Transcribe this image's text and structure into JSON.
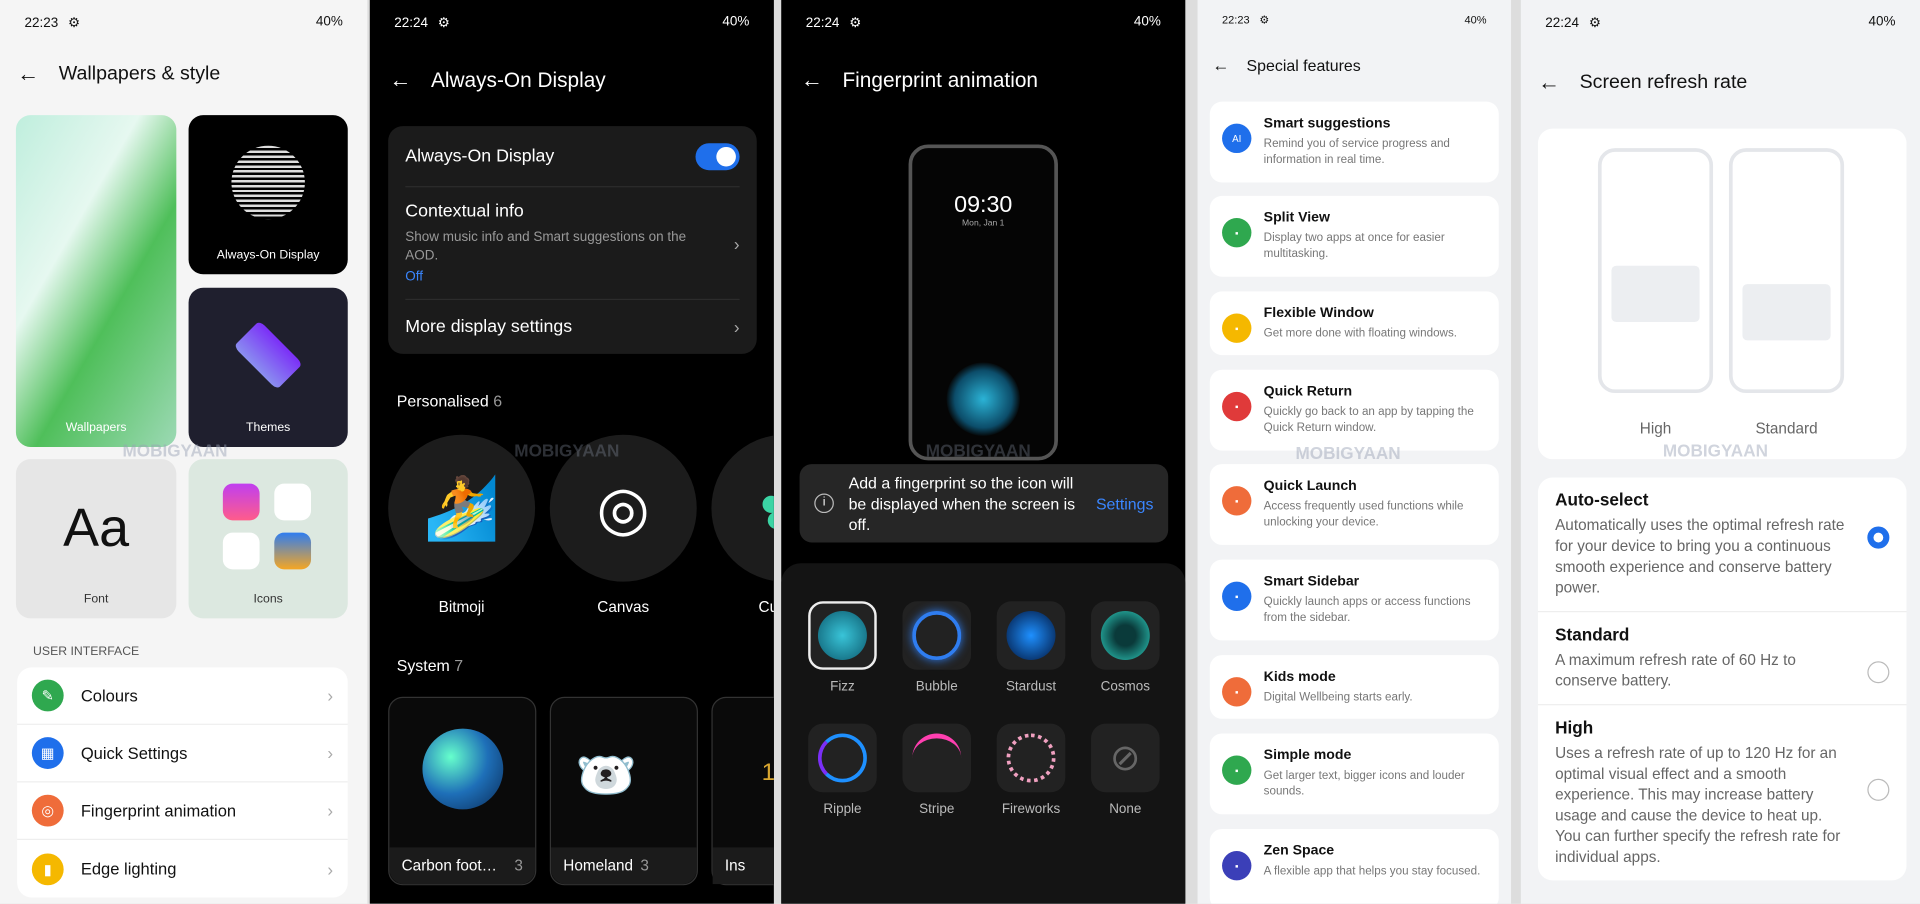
{
  "panel1": {
    "time": "22:23",
    "battery": "40%",
    "title": "Wallpapers & style",
    "tiles": [
      "Wallpapers",
      "Always-On Display",
      "Themes",
      "Font",
      "Icons"
    ],
    "font_sample": "Aa",
    "section": "USER INTERFACE",
    "items": [
      {
        "label": "Colours",
        "color": "#2fa84f"
      },
      {
        "label": "Quick Settings",
        "color": "#1f6feb"
      },
      {
        "label": "Fingerprint animation",
        "color": "#ef6c3a"
      },
      {
        "label": "Edge lighting",
        "color": "#f5b800"
      }
    ]
  },
  "panel2": {
    "time": "22:24",
    "battery": "40%",
    "title": "Always-On Display",
    "aod_label": "Always-On Display",
    "aod_on": true,
    "contextual_title": "Contextual info",
    "contextual_desc": "Show music info and Smart suggestions on the AOD.",
    "contextual_value": "Off",
    "more": "More display settings",
    "personalised": "Personalised",
    "personalised_count": "6",
    "personal_items": [
      "Bitmoji",
      "Canvas",
      "Custom"
    ],
    "system": "System",
    "system_count": "7",
    "system_items": [
      {
        "label": "Carbon foot…",
        "count": "3"
      },
      {
        "label": "Homeland",
        "count": "3"
      },
      {
        "label": "Ins"
      }
    ]
  },
  "panel3": {
    "time": "22:24",
    "battery": "40%",
    "title": "Fingerprint animation",
    "clock": "09:30",
    "date": "Mon, Jan 1",
    "notice": "Add a fingerprint so the icon will be displayed when the screen is off.",
    "settings_link": "Settings",
    "animations": [
      "Fizz",
      "Bubble",
      "Stardust",
      "Cosmos",
      "Ripple",
      "Stripe",
      "Fireworks",
      "None"
    ],
    "selected": "Fizz"
  },
  "panel4": {
    "time": "22:23",
    "battery": "40%",
    "title": "Special features",
    "items": [
      {
        "title": "Smart suggestions",
        "desc": "Remind you of service progress and information in real time.",
        "color": "#1f6feb",
        "icon": "AI"
      },
      {
        "title": "Split View",
        "desc": "Display two apps at once for easier multitasking.",
        "color": "#2fa84f"
      },
      {
        "title": "Flexible Window",
        "desc": "Get more done with floating windows.",
        "color": "#f5b800"
      },
      {
        "title": "Quick Return",
        "desc": "Quickly go back to an app by tapping the Quick Return window.",
        "color": "#e03a3a"
      },
      {
        "title": "Quick Launch",
        "desc": "Access frequently used functions while unlocking your device.",
        "color": "#ef6c3a"
      },
      {
        "title": "Smart Sidebar",
        "desc": "Quickly launch apps or access functions from the sidebar.",
        "color": "#1f6feb"
      },
      {
        "title": "Kids mode",
        "desc": "Digital Wellbeing starts early.",
        "color": "#ef6c3a"
      },
      {
        "title": "Simple mode",
        "desc": "Get larger text, bigger icons and louder sounds.",
        "color": "#2fa84f"
      },
      {
        "title": "Zen Space",
        "desc": "A flexible app that helps you stay focused.",
        "color": "#3b3fb8"
      }
    ]
  },
  "panel5": {
    "time": "22:24",
    "battery": "40%",
    "title": "Screen refresh rate",
    "previews": [
      "High",
      "Standard"
    ],
    "options": [
      {
        "title": "Auto-select",
        "desc": "Automatically uses the optimal refresh rate for your device to bring you a continuous smooth experience and conserve battery power.",
        "selected": true
      },
      {
        "title": "Standard",
        "desc": "A maximum refresh rate of 60 Hz to conserve battery.",
        "selected": false
      },
      {
        "title": "High",
        "desc": "Uses a refresh rate of up to 120 Hz for an optimal visual effect and a smooth experience. This may increase battery usage and cause the device to heat up. You can further specify the refresh rate for individual apps.",
        "selected": false
      }
    ]
  },
  "watermark": "MOBIGYAAN"
}
